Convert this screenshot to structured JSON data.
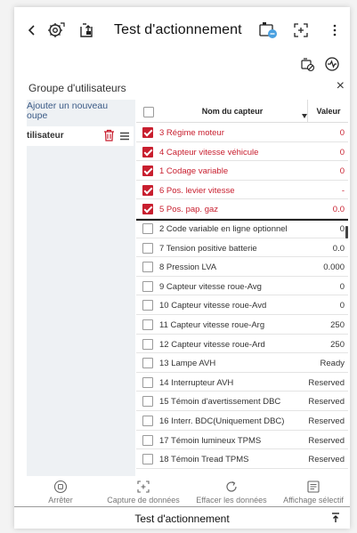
{
  "header": {
    "title": "Test d'actionnement"
  },
  "group": {
    "title": "Groupe d'utilisateurs",
    "close": "×"
  },
  "left_panel": {
    "add_label_line1": "Ajouter un nouveau",
    "add_label_line2": "oupe",
    "user_label": "tilisateur"
  },
  "table": {
    "col_name": "Nom du capteur",
    "col_value": "Valeur",
    "rows": [
      {
        "name": "3 Régime moteur",
        "value": "0",
        "checked": true
      },
      {
        "name": "4 Capteur vitesse véhicule",
        "value": "0",
        "checked": true
      },
      {
        "name": "1 Codage variable",
        "value": "0",
        "checked": true
      },
      {
        "name": "6 Pos. levier vitesse",
        "value": "-",
        "checked": true
      },
      {
        "name": "5 Pos. pap. gaz",
        "value": "0.0",
        "checked": true
      },
      {
        "name": "2 Code variable en ligne optionnel",
        "value": "0",
        "checked": false
      },
      {
        "name": "7 Tension positive batterie",
        "value": "0.0",
        "checked": false
      },
      {
        "name": "8 Pression LVA",
        "value": "0.000",
        "checked": false
      },
      {
        "name": "9 Capteur vitesse roue-Avg",
        "value": "0",
        "checked": false
      },
      {
        "name": "10 Capteur vitesse roue-Avd",
        "value": "0",
        "checked": false
      },
      {
        "name": "11 Capteur vitesse roue-Arg",
        "value": "250",
        "checked": false
      },
      {
        "name": "12 Capteur vitesse roue-Ard",
        "value": "250",
        "checked": false
      },
      {
        "name": "13 Lampe AVH",
        "value": "Ready",
        "checked": false
      },
      {
        "name": "14 Interrupteur AVH",
        "value": "Reserved",
        "checked": false
      },
      {
        "name": "15 Témoin d'avertissement DBC",
        "value": "Reserved",
        "checked": false
      },
      {
        "name": "16 Interr. BDC(Uniquement DBC)",
        "value": "Reserved",
        "checked": false
      },
      {
        "name": "17 Témoin lumineux TPMS",
        "value": "Reserved",
        "checked": false
      },
      {
        "name": "18 Témoin Tread TPMS",
        "value": "Reserved",
        "checked": false
      }
    ]
  },
  "toolbar": {
    "stop": "Arrêter",
    "capture": "Capture de données",
    "clear": "Effacer les données",
    "selective": "Affichage sélectif"
  },
  "footer": {
    "title": "Test d'actionnement"
  },
  "colors": {
    "accent_red": "#c81e2e",
    "left_panel_bg": "#eef1f4",
    "link_blue": "#3a5a86"
  },
  "icons": [
    "back-icon",
    "settings-gear-icon",
    "export-icon",
    "battery-icon",
    "capture-icon",
    "more-icon",
    "car-filter-icon",
    "record-icon",
    "trash-icon",
    "menu-icon",
    "stop-icon",
    "refresh-icon",
    "selective-display-icon",
    "pin-icon"
  ]
}
